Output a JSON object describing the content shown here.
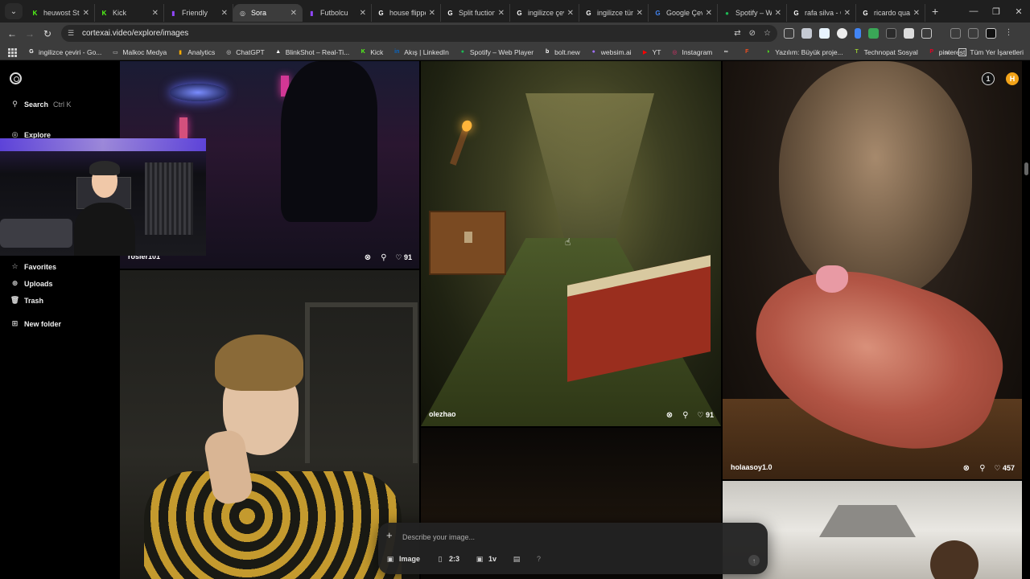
{
  "browser": {
    "tabs": [
      {
        "label": "heuwost Str",
        "favicon": "kick-icon",
        "color": "#53fc18",
        "glyph": "K"
      },
      {
        "label": "Kick",
        "favicon": "kick-icon",
        "color": "#53fc18",
        "glyph": "K"
      },
      {
        "label": "Friendly",
        "favicon": "twitch-icon",
        "color": "#9147ff",
        "glyph": "▮"
      },
      {
        "label": "Sora",
        "favicon": "sora-icon",
        "color": "#dddddd",
        "glyph": "◎",
        "active": true
      },
      {
        "label": "Futbolcu",
        "favicon": "twitch-icon",
        "color": "#9147ff",
        "glyph": "▮"
      },
      {
        "label": "house flippe",
        "favicon": "google-icon",
        "color": "#ffffff",
        "glyph": "G"
      },
      {
        "label": "Split fuction",
        "favicon": "google-icon",
        "color": "#ffffff",
        "glyph": "G"
      },
      {
        "label": "ingilizce çev",
        "favicon": "google-icon",
        "color": "#ffffff",
        "glyph": "G"
      },
      {
        "label": "ingilizce tür",
        "favicon": "google-icon",
        "color": "#ffffff",
        "glyph": "G"
      },
      {
        "label": "Google Çev",
        "favicon": "google-translate-icon",
        "color": "#4285f4",
        "glyph": "G"
      },
      {
        "label": "Spotify – We",
        "favicon": "spotify-icon",
        "color": "#1db954",
        "glyph": "●"
      },
      {
        "label": "rafa silva - G",
        "favicon": "google-icon",
        "color": "#ffffff",
        "glyph": "G"
      },
      {
        "label": "ricardo qua",
        "favicon": "google-icon",
        "color": "#ffffff",
        "glyph": "G"
      }
    ],
    "new_tab": "+",
    "url": "cortexai.video/explore/images",
    "bookmarks": [
      {
        "label": "ingilizce çeviri - Go...",
        "icon": "google-icon",
        "color": "#ffffff",
        "glyph": "G"
      },
      {
        "label": "Malkoc Medya",
        "icon": "folder-icon",
        "color": "#c8c8c8",
        "glyph": "▭"
      },
      {
        "label": "Analytics",
        "icon": "analytics-icon",
        "color": "#f9ab00",
        "glyph": "▮"
      },
      {
        "label": "ChatGPT",
        "icon": "chatgpt-icon",
        "color": "#dddddd",
        "glyph": "◎"
      },
      {
        "label": "BlinkShot – Real-Ti...",
        "icon": "blinkshot-icon",
        "color": "#ffffff",
        "glyph": "▲"
      },
      {
        "label": "Kick",
        "icon": "kick-icon",
        "color": "#53fc18",
        "glyph": "K"
      },
      {
        "label": "Akış | LinkedIn",
        "icon": "linkedin-icon",
        "color": "#0a66c2",
        "glyph": "in"
      },
      {
        "label": "Spotify – Web Player",
        "icon": "spotify-icon",
        "color": "#1db954",
        "glyph": "●"
      },
      {
        "label": "bolt.new",
        "icon": "bolt-icon",
        "color": "#ffffff",
        "glyph": "b"
      },
      {
        "label": "websim.ai",
        "icon": "websim-icon",
        "color": "#a070ff",
        "glyph": "●"
      },
      {
        "label": "YT",
        "icon": "youtube-icon",
        "color": "#ff0000",
        "glyph": "▶"
      },
      {
        "label": "Instagram",
        "icon": "instagram-icon",
        "color": "#e1306c",
        "glyph": "◎"
      },
      {
        "label": "",
        "icon": "link-icon",
        "color": "#dddddd",
        "glyph": "∞"
      },
      {
        "label": "",
        "icon": "figma-icon",
        "color": "#f24e1e",
        "glyph": "F"
      },
      {
        "label": "Yazılım: Büyük proje...",
        "icon": "yazilim-icon",
        "color": "#53fc18",
        "glyph": "◑"
      },
      {
        "label": "Technopat Sosyal",
        "icon": "technopat-icon",
        "color": "#9acd32",
        "glyph": "T"
      },
      {
        "label": "pinterest",
        "icon": "pinterest-icon",
        "color": "#e60023",
        "glyph": "P"
      }
    ],
    "all_bookmarks": "Tüm Yer İşaretleri"
  },
  "sidebar": {
    "search_label": "Search",
    "search_shortcut": "Ctrl K",
    "explore_label": "Explore",
    "items": [
      {
        "label": "Favorites",
        "icon": "star-icon",
        "glyph": "☆"
      },
      {
        "label": "Uploads",
        "icon": "upload-icon",
        "glyph": "⊕"
      },
      {
        "label": "Trash",
        "icon": "trash-icon",
        "glyph": "🗑"
      }
    ],
    "new_folder_label": "New folder"
  },
  "gallery": {
    "cards": [
      {
        "id": "city",
        "user": "rosier101",
        "likes": "91"
      },
      {
        "id": "backrooms",
        "user": "olezhao",
        "likes": "91"
      },
      {
        "id": "cat",
        "user": "holaasoy1.0",
        "likes": "457"
      }
    ]
  },
  "header_widgets": {
    "notif": "1",
    "avatar": "H"
  },
  "composer": {
    "placeholder": "Describe your image...",
    "type_label": "Image",
    "ratio_label": "2:3",
    "count_label": "1v",
    "help": "?"
  },
  "colors": {
    "accent": "#f2a318",
    "background": "#000000"
  }
}
